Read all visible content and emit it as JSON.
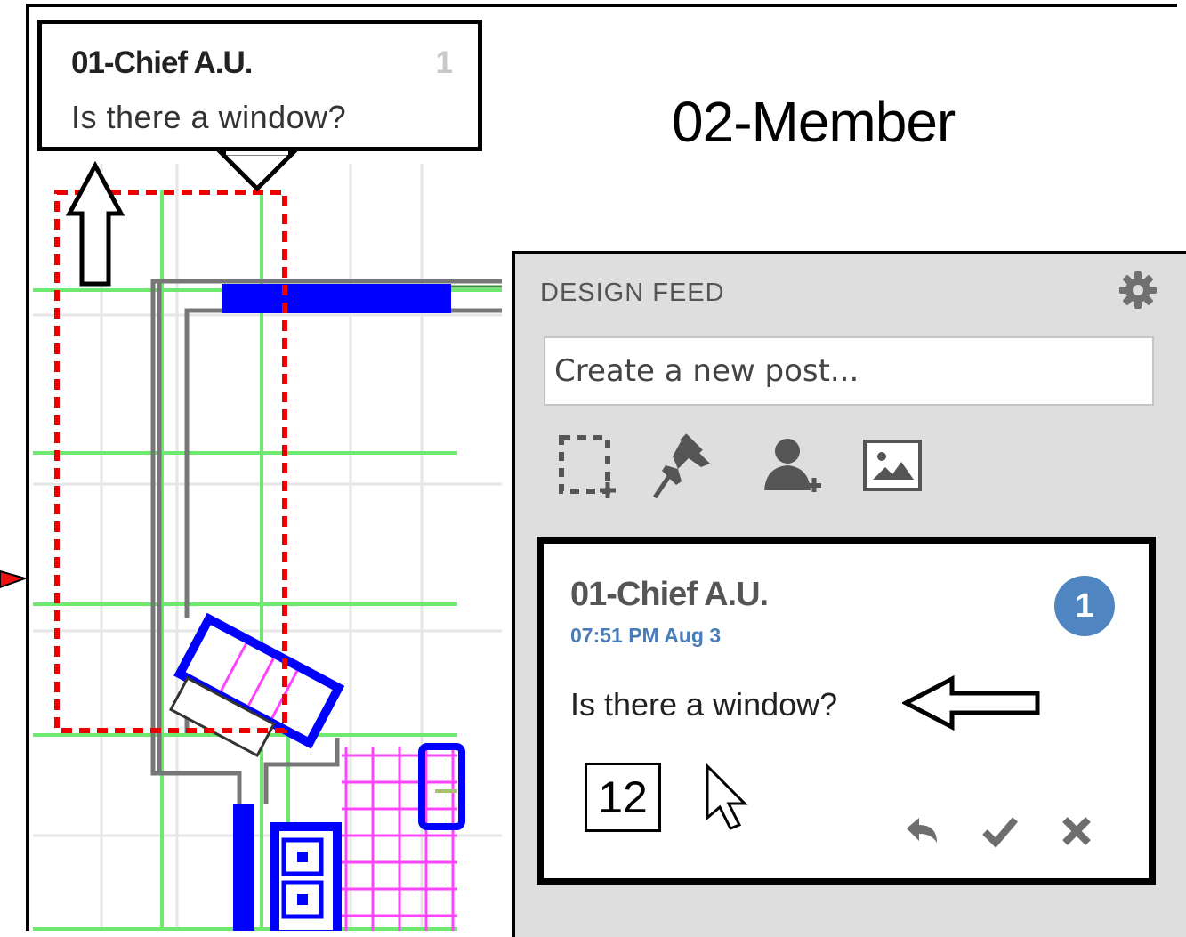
{
  "plan_callout": {
    "author": "01-Chief A.U.",
    "count": "1",
    "message": "Is there a window?"
  },
  "member_title": "02-Member",
  "design_feed": {
    "heading": "DESIGN FEED",
    "new_post_placeholder": "Create a new post...",
    "toolbar_icons": [
      "select-region-icon",
      "pin-icon",
      "add-user-icon",
      "image-icon"
    ],
    "post": {
      "author": "01-Chief A.U.",
      "timestamp": "07:51 PM Aug 3",
      "badge": "1",
      "message": "Is there a window?",
      "step_number": "12",
      "actions": [
        "reply-icon",
        "resolve-check-icon",
        "close-icon"
      ]
    }
  },
  "colors": {
    "grid_green": "#6ee86e",
    "wall_gray": "#777777",
    "window_blue": "#0000ff",
    "tile_magenta": "#ff44ff",
    "selection_red": "#ee0000",
    "badge_blue": "#4f86c2",
    "timestamp_blue": "#4a7db8",
    "feed_bg": "#dedede"
  }
}
